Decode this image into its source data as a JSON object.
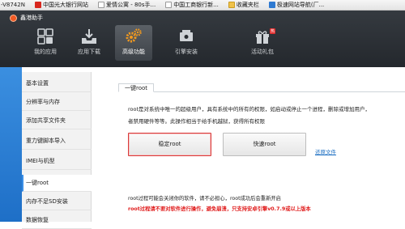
{
  "browser": {
    "address_prefix": "-V8742N",
    "bookmarks": [
      {
        "label": "中国光大银行网站",
        "favicon": "red"
      },
      {
        "label": "爱情公寓 - 80s手...",
        "favicon": "doc"
      },
      {
        "label": "中国工商银行新...",
        "favicon": "doc"
      },
      {
        "label": "收藏夹栏",
        "favicon": "folder"
      },
      {
        "label": "极速网站导航(厂...",
        "favicon": "blue"
      }
    ]
  },
  "app": {
    "title": "鑫港助手",
    "nav": [
      {
        "label": "我的应用",
        "icon": "apps-icon"
      },
      {
        "label": "应用下载",
        "icon": "download-tray-icon"
      },
      {
        "label": "高级功能",
        "icon": "gears-icon",
        "active": true
      },
      {
        "label": "引擎安装",
        "icon": "engine-icon"
      },
      {
        "label": "活动礼包",
        "icon": "gift-icon",
        "badge": "热"
      }
    ]
  },
  "sidebar": {
    "items": [
      {
        "label": "基本设置"
      },
      {
        "label": "分辨率与内存"
      },
      {
        "label": "添加共享文件夹"
      },
      {
        "label": "重力键脚本导入"
      },
      {
        "label": "IMEI与机型"
      },
      {
        "label": "一键root",
        "active": true
      },
      {
        "label": "内存不足SD安装"
      },
      {
        "label": "数据恢复"
      }
    ]
  },
  "main": {
    "tab_label": "一键root",
    "desc_line1": "root是对系统中唯一的超级用户，具有系统中的所有的权限，如启动或停止一个进程，删除或增加用户，",
    "desc_line2": "者禁用硬件等等。此操作相当于给手机越狱，获得所有权限",
    "stable_root_button": "稳定root",
    "quick_root_button": "快速root",
    "restore_link": "还原文件",
    "note": "root过程可能会关闭你的软件，请不必担心，root成功后会重新开启",
    "warning": "root过程请不要对软件进行操作，避免崩溃，只支持安卓引擎v0.7.9或以上版本"
  },
  "colors": {
    "header_bg": "#2a2e33",
    "accent_orange": "#f39a1e",
    "link_blue": "#1b6ec2",
    "warning_red": "#e01b1b",
    "sidebar_active_border": "#3a8ee6"
  }
}
